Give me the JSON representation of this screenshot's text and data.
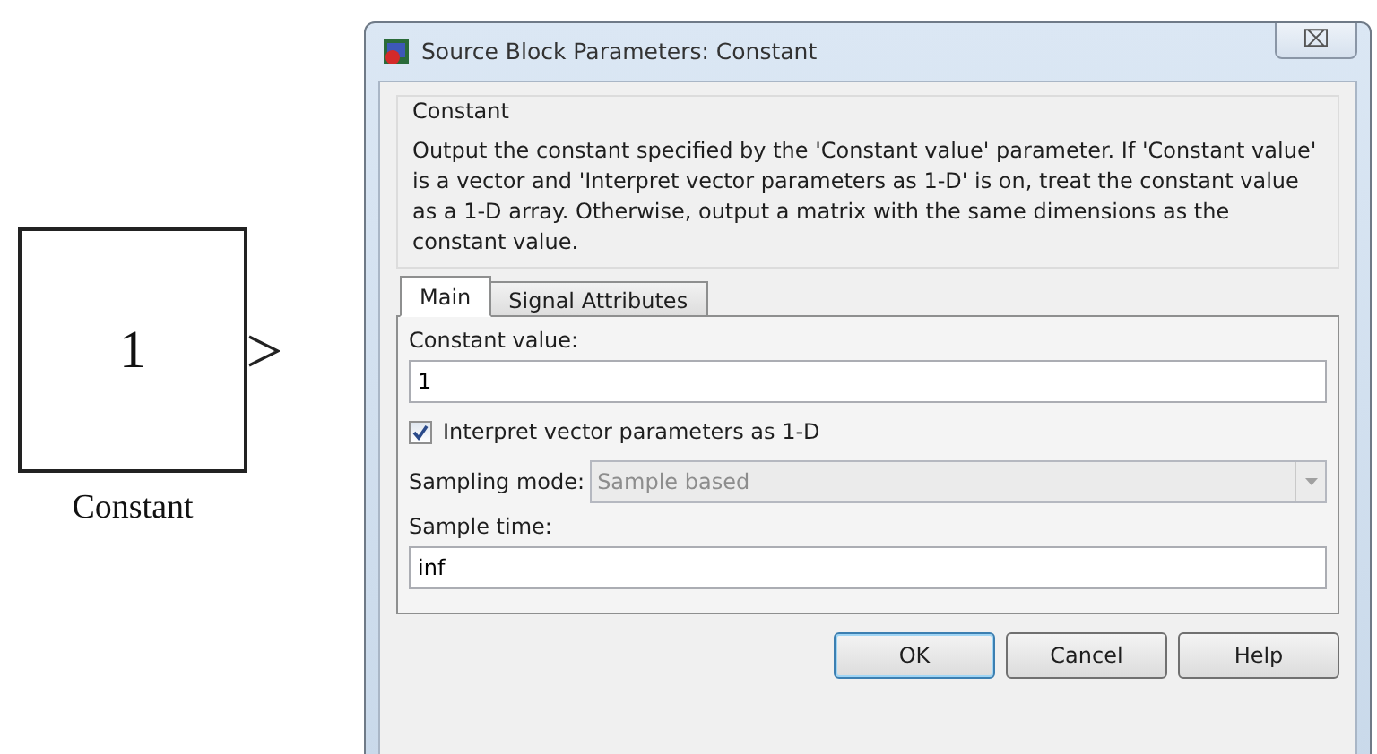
{
  "block": {
    "value": "1",
    "name": "Constant"
  },
  "window": {
    "title": "Source Block Parameters: Constant",
    "close": "⌧"
  },
  "description": {
    "heading": "Constant",
    "text": "Output the constant specified by the 'Constant value' parameter. If 'Constant value' is a vector and 'Interpret vector parameters as 1-D' is on, treat the constant value as a 1-D array. Otherwise, output a matrix with the same dimensions as the constant value."
  },
  "tabs": [
    {
      "label": "Main",
      "selected": true
    },
    {
      "label": "Signal Attributes",
      "selected": false
    }
  ],
  "fields": [
    {
      "kind": "text",
      "label": "Constant value:",
      "value": "1"
    },
    {
      "kind": "checkbox",
      "label": "Interpret vector parameters as 1-D",
      "checked": true
    },
    {
      "kind": "select",
      "label": "Sampling mode:",
      "value": "Sample based",
      "disabled": true
    },
    {
      "kind": "text",
      "label": "Sample time:",
      "value": "inf"
    }
  ],
  "buttons": [
    {
      "label": "OK",
      "default": true
    },
    {
      "label": "Cancel",
      "default": false
    },
    {
      "label": "Help",
      "default": false
    }
  ]
}
